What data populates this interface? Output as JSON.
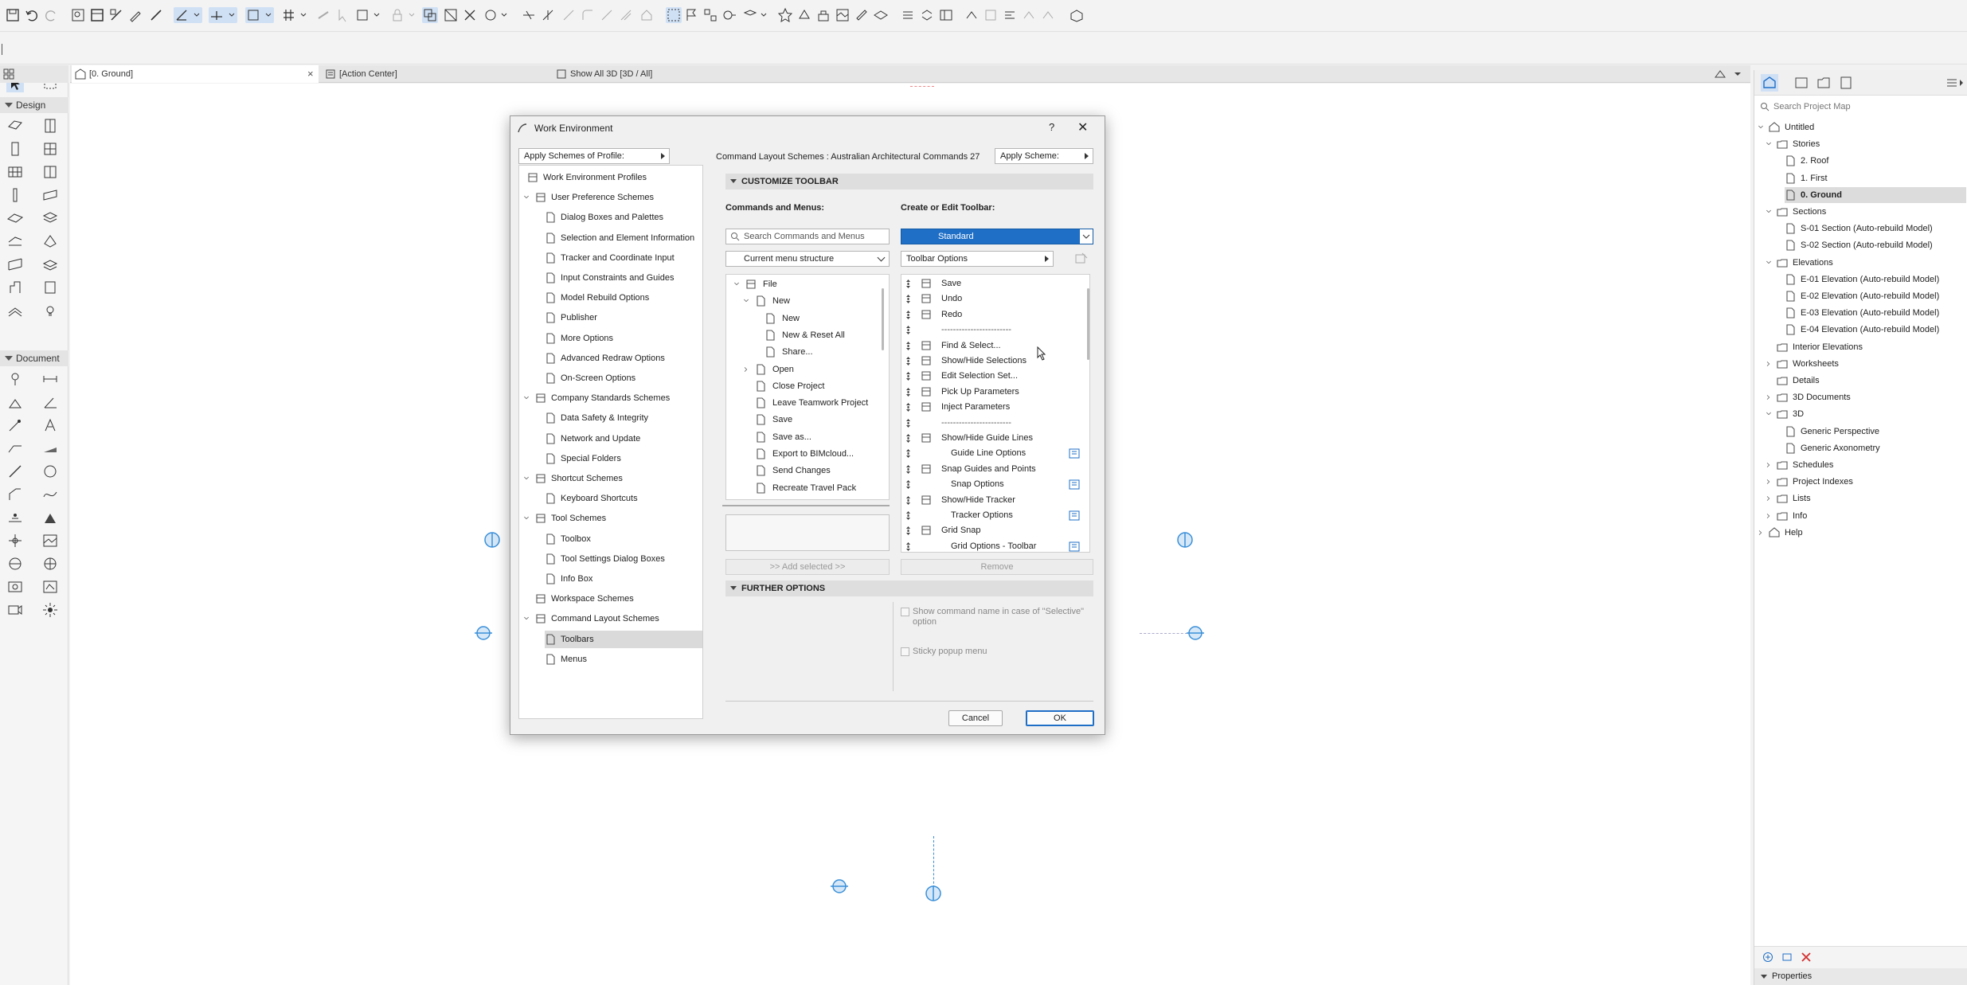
{
  "app": {
    "tabs": [
      {
        "label": "[0. Ground]"
      },
      {
        "label": "[Action Center]"
      },
      {
        "label": "Show All 3D [3D / All]"
      }
    ],
    "tab_close": "×"
  },
  "toolbox": {
    "sections": [
      {
        "label": "Design"
      },
      {
        "label": "Document"
      }
    ]
  },
  "navigator": {
    "search_placeholder": "Search Project Map",
    "items": [
      {
        "label": "Untitled",
        "icon": "project-icon"
      },
      {
        "label": "Stories",
        "icon": "stories-icon"
      },
      {
        "label": "2. Roof",
        "icon": "story-icon"
      },
      {
        "label": "1. First",
        "icon": "story-icon"
      },
      {
        "label": "0. Ground",
        "icon": "story-icon"
      },
      {
        "label": "Sections",
        "icon": "sections-icon"
      },
      {
        "label": "S-01 Section (Auto-rebuild Model)",
        "icon": "section-icon"
      },
      {
        "label": "S-02 Section (Auto-rebuild Model)",
        "icon": "section-icon"
      },
      {
        "label": "Elevations",
        "icon": "elevations-icon"
      },
      {
        "label": "E-01 Elevation (Auto-rebuild Model)",
        "icon": "elevation-icon"
      },
      {
        "label": "E-02 Elevation (Auto-rebuild Model)",
        "icon": "elevation-icon"
      },
      {
        "label": "E-03 Elevation (Auto-rebuild Model)",
        "icon": "elevation-icon"
      },
      {
        "label": "E-04 Elevation (Auto-rebuild Model)",
        "icon": "elevation-icon"
      },
      {
        "label": "Interior Elevations",
        "icon": "interior-elevations-icon"
      },
      {
        "label": "Worksheets",
        "icon": "worksheets-icon"
      },
      {
        "label": "Details",
        "icon": "details-icon"
      },
      {
        "label": "3D Documents",
        "icon": "3d-documents-icon"
      },
      {
        "label": "3D",
        "icon": "3d-icon"
      },
      {
        "label": "Generic Perspective",
        "icon": "perspective-icon"
      },
      {
        "label": "Generic Axonometry",
        "icon": "axonometry-icon"
      },
      {
        "label": "Schedules",
        "icon": "schedules-icon"
      },
      {
        "label": "Project Indexes",
        "icon": "project-indexes-icon"
      },
      {
        "label": "Lists",
        "icon": "lists-icon"
      },
      {
        "label": "Info",
        "icon": "info-icon"
      },
      {
        "label": "Help",
        "icon": "help-icon"
      }
    ],
    "properties_label": "Properties"
  },
  "dialog": {
    "title": "Work Environment",
    "help": "?",
    "close": "✕",
    "apply_profile": "Apply Schemes of Profile:",
    "scheme_label": "Command Layout Schemes : Australian Architectural Commands 27",
    "apply_scheme": "Apply Scheme:",
    "tree": [
      {
        "label": "Work Environment Profiles",
        "level": 0
      },
      {
        "label": "User Preference Schemes",
        "level": 0
      },
      {
        "label": "Dialog Boxes and Palettes",
        "level": 1
      },
      {
        "label": "Selection and Element Information",
        "level": 1
      },
      {
        "label": "Tracker and Coordinate Input",
        "level": 1
      },
      {
        "label": "Input Constraints and Guides",
        "level": 1
      },
      {
        "label": "Model Rebuild Options",
        "level": 1
      },
      {
        "label": "Publisher",
        "level": 1
      },
      {
        "label": "More Options",
        "level": 1
      },
      {
        "label": "Advanced Redraw Options",
        "level": 1
      },
      {
        "label": "On-Screen Options",
        "level": 1
      },
      {
        "label": "Company Standards Schemes",
        "level": 0
      },
      {
        "label": "Data Safety & Integrity",
        "level": 1
      },
      {
        "label": "Network and Update",
        "level": 1
      },
      {
        "label": "Special Folders",
        "level": 1
      },
      {
        "label": "Shortcut Schemes",
        "level": 0
      },
      {
        "label": "Keyboard Shortcuts",
        "level": 1
      },
      {
        "label": "Tool Schemes",
        "level": 0
      },
      {
        "label": "Toolbox",
        "level": 1
      },
      {
        "label": "Tool Settings Dialog Boxes",
        "level": 1
      },
      {
        "label": "Info Box",
        "level": 1
      },
      {
        "label": "Workspace Schemes",
        "level": 0
      },
      {
        "label": "Command Layout Schemes",
        "level": 0
      },
      {
        "label": "Toolbars",
        "level": 1
      },
      {
        "label": "Menus",
        "level": 1
      }
    ],
    "customize_toolbar": "CUSTOMIZE TOOLBAR",
    "commands_menus_label": "Commands and Menus:",
    "create_edit_label": "Create or Edit Toolbar:",
    "search_placeholder": "Search Commands and Menus",
    "toolbar_selected": "Standard",
    "menu_structure": "Current menu structure",
    "toolbar_options": "Toolbar Options",
    "commands": [
      {
        "label": "File",
        "level": 0
      },
      {
        "label": "New",
        "level": 1
      },
      {
        "label": "New",
        "level": 2
      },
      {
        "label": "New & Reset All",
        "level": 2
      },
      {
        "label": "Share...",
        "level": 2
      },
      {
        "label": "Open",
        "level": 1
      },
      {
        "label": "Close Project",
        "level": 1
      },
      {
        "label": "Leave Teamwork Project",
        "level": 1
      },
      {
        "label": "Save",
        "level": 1
      },
      {
        "label": "Save as...",
        "level": 1
      },
      {
        "label": "Export to BIMcloud...",
        "level": 1
      },
      {
        "label": "Send Changes",
        "level": 1
      },
      {
        "label": "Recreate Travel Pack",
        "level": 1
      }
    ],
    "toolbar_items": [
      {
        "label": "Save",
        "sub": false
      },
      {
        "label": "Undo",
        "sub": false
      },
      {
        "label": "Redo",
        "sub": false
      },
      {
        "label": "------------------------",
        "sub": false
      },
      {
        "label": "Find & Select...",
        "sub": false
      },
      {
        "label": "Show/Hide Selections",
        "sub": false
      },
      {
        "label": "Edit Selection Set...",
        "sub": false
      },
      {
        "label": "Pick Up Parameters",
        "sub": false
      },
      {
        "label": "Inject Parameters",
        "sub": false
      },
      {
        "label": "------------------------",
        "sub": false
      },
      {
        "label": "Show/Hide Guide Lines",
        "sub": false
      },
      {
        "label": "Guide Line Options",
        "sub": true
      },
      {
        "label": "Snap Guides and Points",
        "sub": false
      },
      {
        "label": "Snap Options",
        "sub": true
      },
      {
        "label": "Show/Hide Tracker",
        "sub": false
      },
      {
        "label": "Tracker Options",
        "sub": true
      },
      {
        "label": "Grid Snap",
        "sub": false
      },
      {
        "label": "Grid Options - Toolbar",
        "sub": true
      }
    ],
    "add_selected": ">> Add selected >>",
    "remove": "Remove",
    "further_options": "FURTHER OPTIONS",
    "option_selective": "Show command name in case of \"Selective\" option",
    "option_selective_line1": "Show command name in case of \"Selective\"",
    "option_selective_line2": "option",
    "option_sticky": "Sticky popup menu",
    "cancel": "Cancel",
    "ok": "OK"
  },
  "colors": {
    "accent": "#1f6fc7",
    "marker": "#3a8fd8"
  }
}
